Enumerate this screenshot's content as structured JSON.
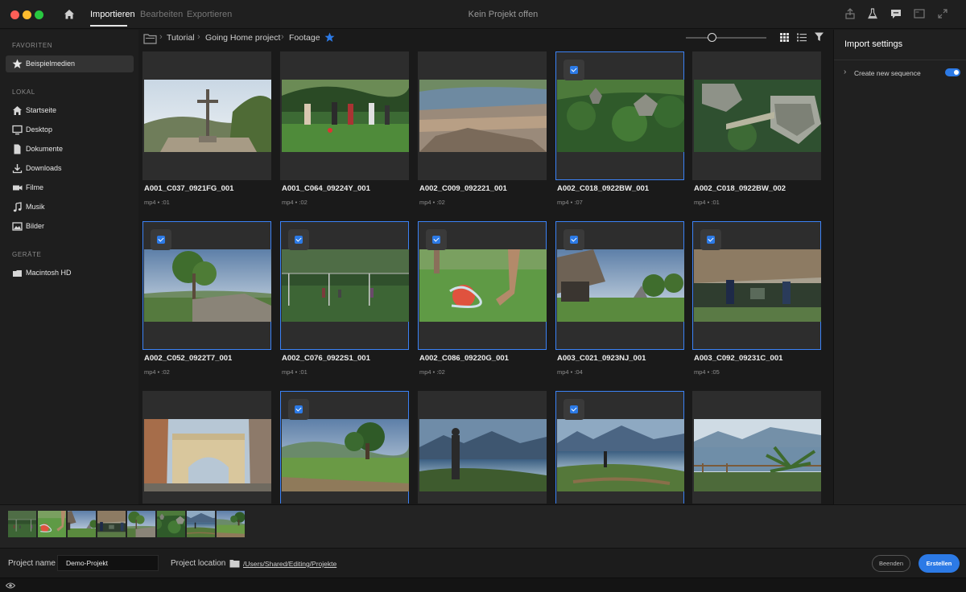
{
  "titlebar": {
    "tabs": [
      "Importieren",
      "Bearbeiten",
      "Exportieren"
    ],
    "active_tab": 0,
    "window_title": "Kein Projekt offen"
  },
  "sidebar": {
    "favorites_label": "FAVORITEN",
    "favorites": [
      {
        "label": "Beispielmedien",
        "icon": "star-icon"
      }
    ],
    "local_label": "LOKAL",
    "local": [
      {
        "label": "Startseite",
        "icon": "home-icon"
      },
      {
        "label": "Desktop",
        "icon": "monitor-icon"
      },
      {
        "label": "Dokumente",
        "icon": "document-icon"
      },
      {
        "label": "Downloads",
        "icon": "download-icon"
      },
      {
        "label": "Filme",
        "icon": "video-camera-icon"
      },
      {
        "label": "Musik",
        "icon": "music-note-icon"
      },
      {
        "label": "Bilder",
        "icon": "image-icon"
      }
    ],
    "devices_label": "GERÄTE",
    "devices": [
      {
        "label": "Macintosh HD",
        "icon": "drive-icon"
      }
    ]
  },
  "breadcrumb": {
    "items": [
      "Tutorial",
      "Going Home project",
      "Footage"
    ]
  },
  "grid": {
    "items": [
      {
        "name": "A001_C037_0921FG_001",
        "meta": "mp4 • :01",
        "selected": false,
        "scene": "cross"
      },
      {
        "name": "A001_C064_09224Y_001",
        "meta": "mp4 • :02",
        "selected": false,
        "scene": "soccer"
      },
      {
        "name": "A002_C009_092221_001",
        "meta": "mp4 • :02",
        "selected": false,
        "scene": "town"
      },
      {
        "name": "A002_C018_0922BW_001",
        "meta": "mp4 • :07",
        "selected": true,
        "scene": "jungle"
      },
      {
        "name": "A002_C018_0922BW_002",
        "meta": "mp4 • :01",
        "selected": false,
        "scene": "ruins"
      },
      {
        "name": "A002_C052_0922T7_001",
        "meta": "mp4 • :02",
        "selected": true,
        "scene": "tree"
      },
      {
        "name": "A002_C076_0922S1_001",
        "meta": "mp4 • :01",
        "selected": true,
        "scene": "field"
      },
      {
        "name": "A002_C086_09220G_001",
        "meta": "mp4 • :02",
        "selected": true,
        "scene": "ball"
      },
      {
        "name": "A003_C021_0923NJ_001",
        "meta": "mp4 • :04",
        "selected": true,
        "scene": "hut"
      },
      {
        "name": "A003_C092_09231C_001",
        "meta": "mp4 • :05",
        "selected": true,
        "scene": "kids"
      },
      {
        "name": "",
        "meta": "",
        "selected": false,
        "scene": "arch"
      },
      {
        "name": "",
        "meta": "",
        "selected": true,
        "scene": "bigtree"
      },
      {
        "name": "",
        "meta": "",
        "selected": false,
        "scene": "woman"
      },
      {
        "name": "",
        "meta": "",
        "selected": true,
        "scene": "lake"
      },
      {
        "name": "",
        "meta": "",
        "selected": false,
        "scene": "palm"
      }
    ]
  },
  "import_settings": {
    "title": "Import settings",
    "option_label": "Create new sequence",
    "option_on": true
  },
  "filmstrip": [
    "field",
    "ball",
    "hut",
    "kids",
    "tree",
    "jungle",
    "lake",
    "bigtree"
  ],
  "bottom": {
    "project_name_label": "Project name",
    "project_name_value": "Demo-Projekt",
    "project_location_label": "Project location",
    "project_location_value": "/Users/Shared/Editing/Projekte",
    "quit_label": "Beenden",
    "create_label": "Erstellen"
  },
  "colors": {
    "accent": "#2c7ae6",
    "selection": "#3b82f6",
    "background": "#1a1a1a"
  }
}
